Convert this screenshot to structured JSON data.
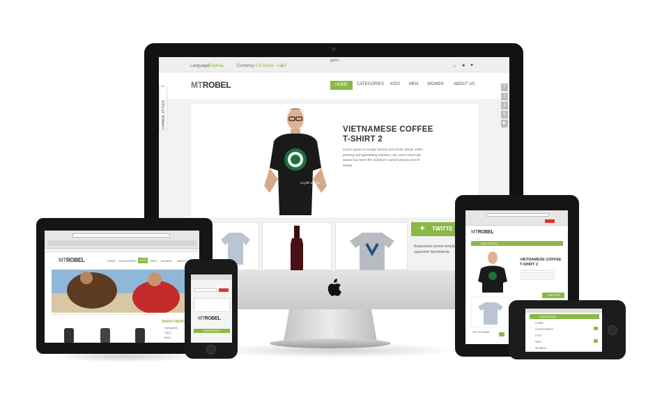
{
  "imac": {
    "top_label": "green",
    "language_label": "Language:",
    "language_value": "English",
    "currency_label": "Currency:",
    "currency_value": "US Dollar - USD",
    "logo_mt": "MT",
    "logo_rest": "ROBEL",
    "nav": [
      "HOME",
      "CATEGORIES",
      "KIDS",
      "MEN",
      "WOMEN",
      "ABOUT US"
    ],
    "side_tab": "CHANGE STYLES",
    "hero_title_1": "VIETNAMESE COFFEE",
    "hero_title_2": "T-SHIRT 2",
    "hero_text": "Lorem Ipsum is simply dummy text of the abcde 100m printing and typesetting industry. L81 ness Lorem lps Ipsum has been the industry's sanard dummy text fe 1500s.",
    "shirt_caption": "cà phê sữa đá",
    "twitter": "TWITTE",
    "tweet": "Responsive joomla template released http://t.co/71Ei4f3 supported #joomlaeoia"
  },
  "left_ipad": {
    "logo_mt": "MT",
    "logo_rest": "ROBEL",
    "nav": [
      "HOME",
      "CATEGORIES",
      "KIDS",
      "MEN",
      "WOMEN",
      "ABOUT US"
    ],
    "smart_menu": "SMART MENU",
    "menu_items": [
      "Categories",
      "KIDS",
      "MEN"
    ]
  },
  "iphone": {
    "logo_mt": "MT",
    "logo_rest": "ROBEL",
    "bar": "NAVIGATION"
  },
  "right_ipad": {
    "logo_mt": "MT",
    "logo_rest": "ROBEL",
    "bar": "NAVIGATION",
    "title_1": "VIETNAMESE COFFEE",
    "title_2": "T-SHIRT 2",
    "twitter": "TWITTER",
    "product": "IXS PHUMAK"
  },
  "landscape_iphone": {
    "bar": "NAVIGATION",
    "items": [
      "HOME",
      "CATEGORIES",
      "KIDS",
      "MEN",
      "WOMEN"
    ]
  },
  "colors": {
    "accent": "#8ab846",
    "frame": "#121212"
  }
}
